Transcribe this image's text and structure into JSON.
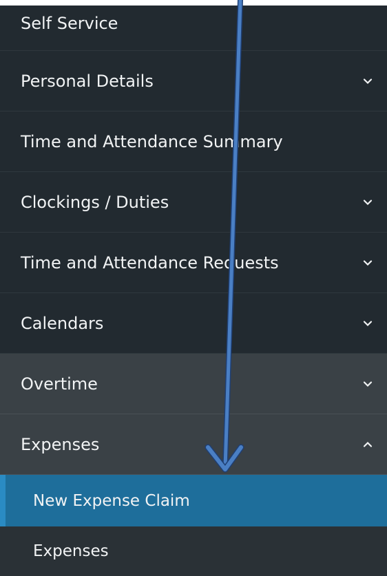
{
  "menu": {
    "items": [
      {
        "label": "Self Service"
      },
      {
        "label": "Personal Details"
      },
      {
        "label": "Time and Attendance Summary"
      },
      {
        "label": "Clockings / Duties"
      },
      {
        "label": "Time and Attendance Requests"
      },
      {
        "label": "Calendars"
      },
      {
        "label": "Overtime"
      },
      {
        "label": "Expenses"
      }
    ],
    "sub_items": [
      {
        "label": "New Expense Claim"
      },
      {
        "label": "Expenses"
      }
    ]
  },
  "colors": {
    "menu_bg": "#222a30",
    "hover_bg": "#3a4146",
    "active_bg": "#1e6e9b",
    "text": "#f1f3f4",
    "arrow": "#4a7fc4"
  },
  "icons": {
    "collapsed": "chevron-down-icon",
    "expanded": "chevron-up-icon"
  }
}
